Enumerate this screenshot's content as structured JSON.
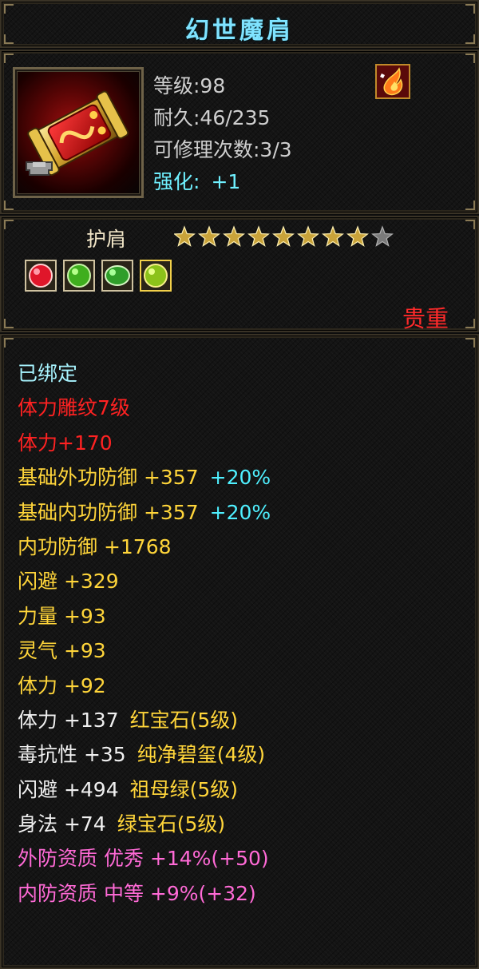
{
  "item": {
    "name": "幻世魔肩",
    "level": "等级:98",
    "durability": "耐久:46/235",
    "repair": "可修理次数:3/3",
    "enhance_label": "强化:",
    "enhance_value": "+1",
    "type": "护肩",
    "rarity": "贵重",
    "stars_filled": 8,
    "stars_total": 9
  },
  "gems": [
    "red-gem-icon",
    "green-gem-icon",
    "green-gem-icon",
    "yellow-green-gem-icon"
  ],
  "attributes": [
    {
      "text": "已绑定",
      "color": "cyan"
    },
    {
      "text": "体力雕纹7级",
      "color": "red"
    },
    {
      "text": "体力+170",
      "color": "red"
    },
    {
      "text": "基础外功防御 +357",
      "color": "yellow",
      "extra": "+20%",
      "extra_color": "teal"
    },
    {
      "text": "基础内功防御 +357",
      "color": "yellow",
      "extra": "+20%",
      "extra_color": "teal"
    },
    {
      "text": "内功防御 +1768",
      "color": "yellow"
    },
    {
      "text": "闪避 +329",
      "color": "yellow"
    },
    {
      "text": "力量 +93",
      "color": "yellow"
    },
    {
      "text": "灵气 +93",
      "color": "yellow"
    },
    {
      "text": "体力 +92",
      "color": "yellow"
    },
    {
      "text": "体力 +137",
      "color": "white",
      "extra": "红宝石(5级)",
      "extra_color": "yellow"
    },
    {
      "text": "毒抗性 +35",
      "color": "white",
      "extra": "纯净碧玺(4级)",
      "extra_color": "yellow"
    },
    {
      "text": "闪避 +494",
      "color": "white",
      "extra": "祖母绿(5级)",
      "extra_color": "yellow"
    },
    {
      "text": "身法 +74",
      "color": "white",
      "extra": "绿宝石(5级)",
      "extra_color": "yellow"
    },
    {
      "text": "外防资质  优秀 +14%(+50)",
      "color": "pink"
    },
    {
      "text": "内防资质  中等 +9%(+32)",
      "color": "pink"
    }
  ]
}
